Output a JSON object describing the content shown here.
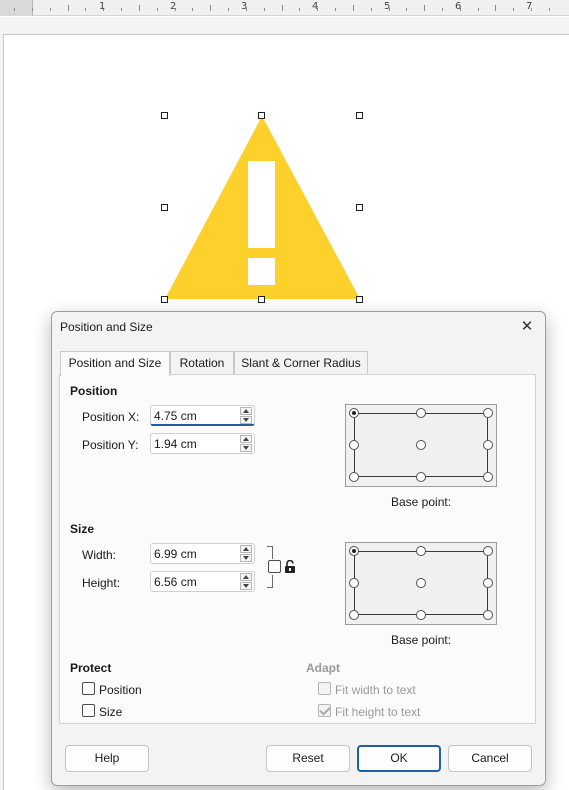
{
  "ruler": {
    "numbers": [
      "1",
      "2",
      "3",
      "4",
      "5",
      "6",
      "7"
    ]
  },
  "document": {
    "shape": {
      "name": "warning-triangle",
      "color": "#FDD02B"
    }
  },
  "dialog": {
    "title": "Position and Size",
    "tabs": [
      {
        "label": "Position and Size",
        "active": true
      },
      {
        "label": "Rotation",
        "active": false
      },
      {
        "label": "Slant & Corner Radius",
        "active": false
      }
    ],
    "position": {
      "heading": "Position",
      "x_label": "Position X:",
      "x_value": "4.75 cm",
      "y_label": "Position Y:",
      "y_value": "1.94 cm",
      "base_point_label": "Base point:"
    },
    "size": {
      "heading": "Size",
      "width_label": "Width:",
      "width_value": "6.99 cm",
      "height_label": "Height:",
      "height_value": "6.56 cm",
      "keep_ratio_checked": false,
      "base_point_label": "Base point:"
    },
    "protect": {
      "heading": "Protect",
      "position_label": "Position",
      "position_checked": false,
      "size_label": "Size",
      "size_checked": false
    },
    "adapt": {
      "heading": "Adapt",
      "fit_width_label": "Fit width to text",
      "fit_width_checked": false,
      "fit_height_label": "Fit height to text",
      "fit_height_checked": true
    },
    "buttons": {
      "help": "Help",
      "reset": "Reset",
      "ok": "OK",
      "cancel": "Cancel"
    }
  }
}
